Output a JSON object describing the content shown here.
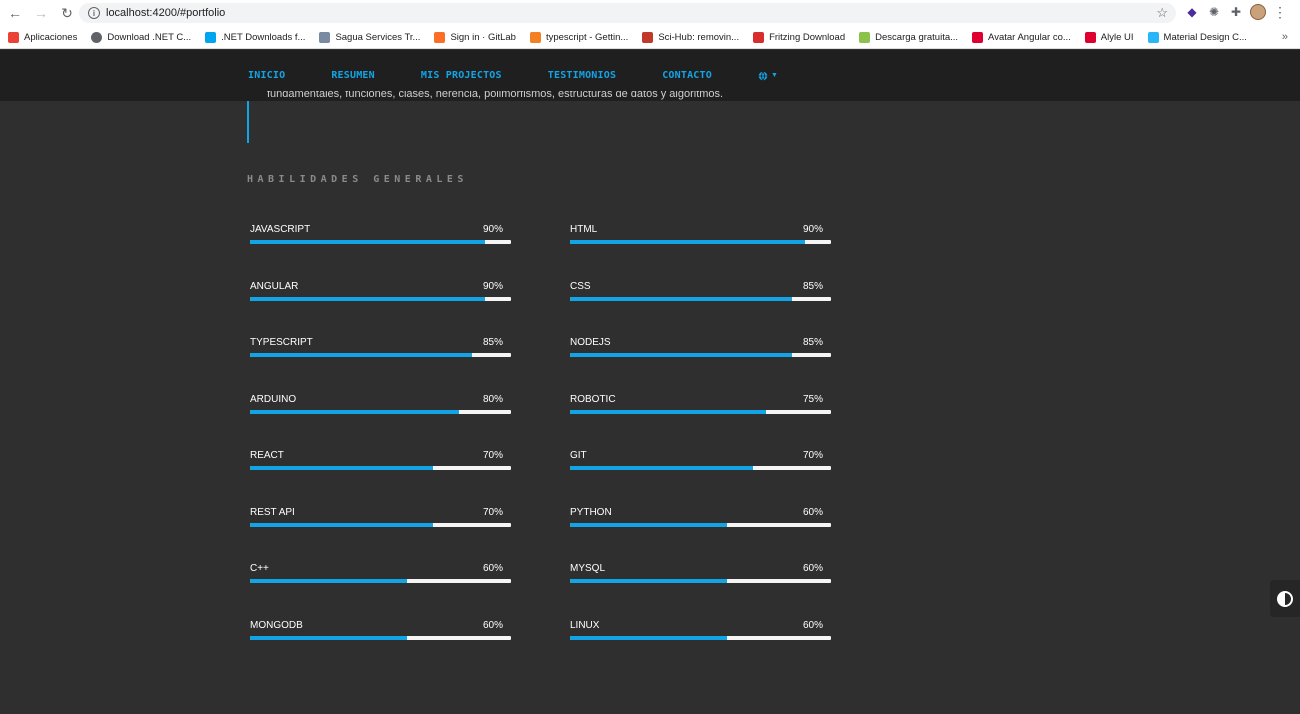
{
  "browser": {
    "url": "localhost:4200/#portfolio",
    "bookmarks": [
      {
        "label": "Aplicaciones",
        "icon": "apps-grid-icon",
        "color": "#ea4335"
      },
      {
        "label": "Download .NET C...",
        "icon": "globe-icon",
        "color": "#5f6368"
      },
      {
        "label": ".NET Downloads f...",
        "icon": "windows-icon",
        "color": "#00a4ef"
      },
      {
        "label": "Sagua Services Tr...",
        "icon": "plane-icon",
        "color": "#7a8aa0"
      },
      {
        "label": "Sign in · GitLab",
        "icon": "gitlab-icon",
        "color": "#fc6d26"
      },
      {
        "label": "typescript - Gettin...",
        "icon": "stackoverflow-icon",
        "color": "#f48024"
      },
      {
        "label": "Sci-Hub: removin...",
        "icon": "scihub-icon",
        "color": "#c0392b"
      },
      {
        "label": "Fritzing Download",
        "icon": "fritzing-icon",
        "color": "#d72d2d"
      },
      {
        "label": "Descarga gratuita...",
        "icon": "download-icon",
        "color": "#8bc34a"
      },
      {
        "label": "Avatar Angular co...",
        "icon": "angular-icon",
        "color": "#dd0031"
      },
      {
        "label": "Alyle UI",
        "icon": "angular-icon",
        "color": "#dd0031"
      },
      {
        "label": "Material Design C...",
        "icon": "material-icon",
        "color": "#29b6f6"
      }
    ],
    "more": "»"
  },
  "nav": {
    "items": [
      "INICIO",
      "RESUMEN",
      "MIS PROJECTOS",
      "TESTIMONIOS",
      "CONTACTO"
    ],
    "language_icon": "globe-icon"
  },
  "quote": {
    "text": "fundamentales, funciones, clases, herencia, polimorfismos, estructuras de datos y algoritmos."
  },
  "skills": {
    "title": "HABILIDADES GENERALES",
    "accent": "#13a4e6",
    "left": [
      {
        "name": "JAVASCRIPT",
        "percent": "90%",
        "value": 90
      },
      {
        "name": "ANGULAR",
        "percent": "90%",
        "value": 90
      },
      {
        "name": "TYPESCRIPT",
        "percent": "85%",
        "value": 85
      },
      {
        "name": "ARDUINO",
        "percent": "80%",
        "value": 80
      },
      {
        "name": "REACT",
        "percent": "70%",
        "value": 70
      },
      {
        "name": "REST API",
        "percent": "70%",
        "value": 70
      },
      {
        "name": "C++",
        "percent": "60%",
        "value": 60
      },
      {
        "name": "MONGODB",
        "percent": "60%",
        "value": 60
      }
    ],
    "right": [
      {
        "name": "HTML",
        "percent": "90%",
        "value": 90
      },
      {
        "name": "CSS",
        "percent": "85%",
        "value": 85
      },
      {
        "name": "NODEJS",
        "percent": "85%",
        "value": 85
      },
      {
        "name": "ROBOTIC",
        "percent": "75%",
        "value": 75
      },
      {
        "name": "GIT",
        "percent": "70%",
        "value": 70
      },
      {
        "name": "PYTHON",
        "percent": "60%",
        "value": 60
      },
      {
        "name": "MYSQL",
        "percent": "60%",
        "value": 60
      },
      {
        "name": "LINUX",
        "percent": "60%",
        "value": 60
      }
    ]
  },
  "theme_toggle_icon": "contrast-icon"
}
